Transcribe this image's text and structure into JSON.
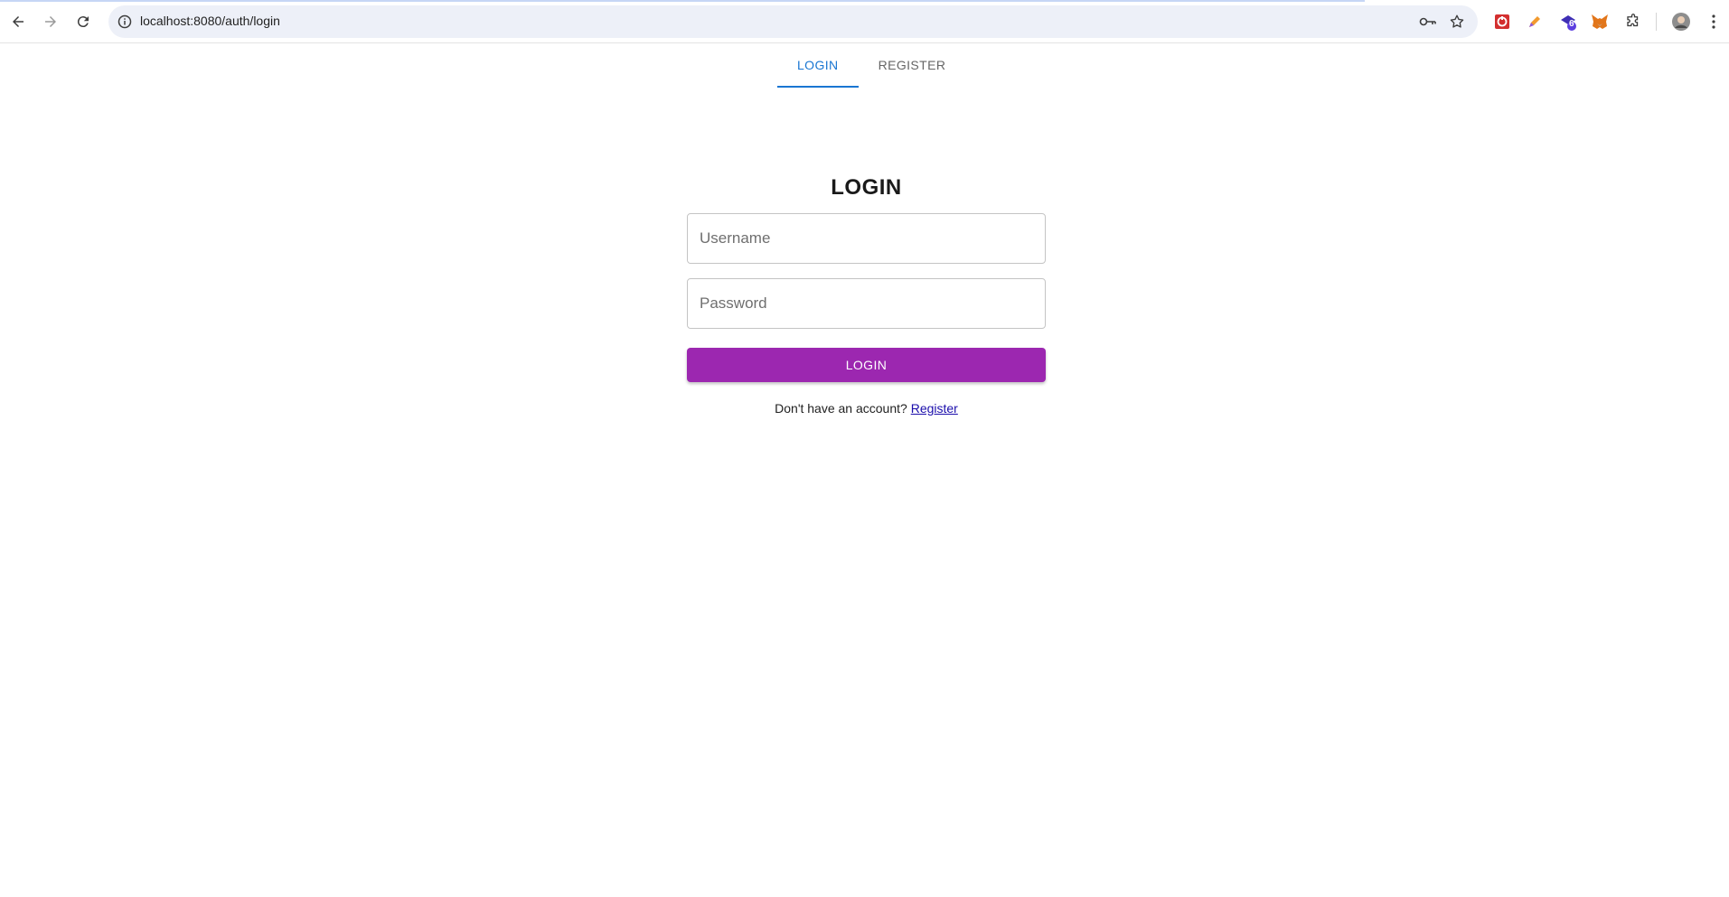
{
  "browser": {
    "url": "localhost:8080/auth/login",
    "extension_badge": "6"
  },
  "tabs": [
    {
      "label": "LOGIN",
      "active": true
    },
    {
      "label": "REGISTER",
      "active": false
    }
  ],
  "form": {
    "title": "LOGIN",
    "username_placeholder": "Username",
    "password_placeholder": "Password",
    "submit_label": "LOGIN",
    "footer_text": "Don't have an account?",
    "footer_link": "Register"
  },
  "colors": {
    "accent_tab": "#1976d2",
    "button": "#9c27b0"
  }
}
